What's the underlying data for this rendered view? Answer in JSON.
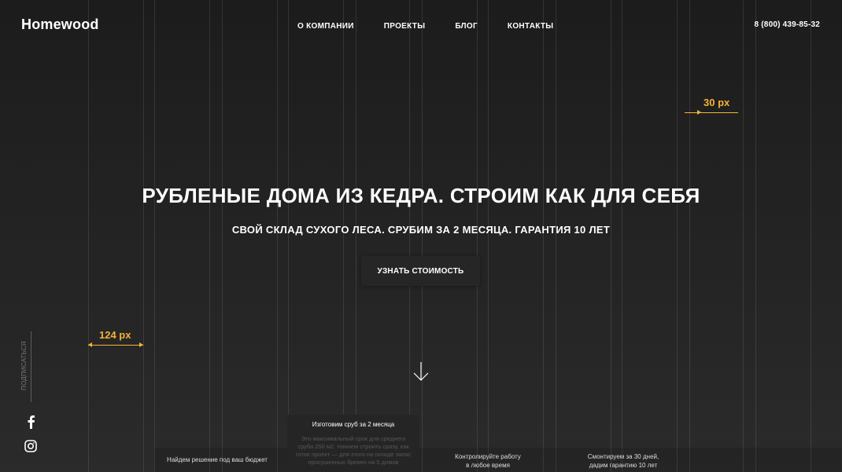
{
  "header": {
    "logo": "Homewood",
    "nav": [
      "О КОМПАНИИ",
      "ПРОЕКТЫ",
      "БЛОГ",
      "КОНТАКТЫ"
    ],
    "phone": "8 (800) 439-85-32"
  },
  "annotations": {
    "top_right_measure": "30 px",
    "left_measure": "124 px"
  },
  "hero": {
    "title": "РУБЛЕНЫЕ ДОМА ИЗ КЕДРА. СТРОИМ КАК ДЛЯ СЕБЯ",
    "subtitle": "СВОЙ СКЛАД СУХОГО ЛЕСА. СРУБИМ ЗА 2 МЕСЯЦА. ГАРАНТИЯ 10 ЛЕТ",
    "cta_label": "УЗНАТЬ СТОИМОСТЬ"
  },
  "social": {
    "subscribe_label": "ПОДПИСАТЬСЯ",
    "icons": [
      "facebook-icon",
      "instagram-icon"
    ]
  },
  "features": {
    "budget": "Найдем решение под ваш бюджет",
    "active_title": "Изготовим сруб за 2 месяца",
    "active_desc": "Это максимальный срок для среднего сруба 250 м2. Начнем строить сразу, как готов проект — для этого на складе запас просушенных бревен на 5 домов",
    "control_line1": "Контролируйте работу",
    "control_line2": "в любое время",
    "assemble_line1": "Смонтируем за 30 дней,",
    "assemble_line2": "дадим гарантию 10 лет"
  },
  "colors": {
    "background": "#1e1e1e",
    "accent": "#f5b336",
    "text": "#ffffff"
  }
}
